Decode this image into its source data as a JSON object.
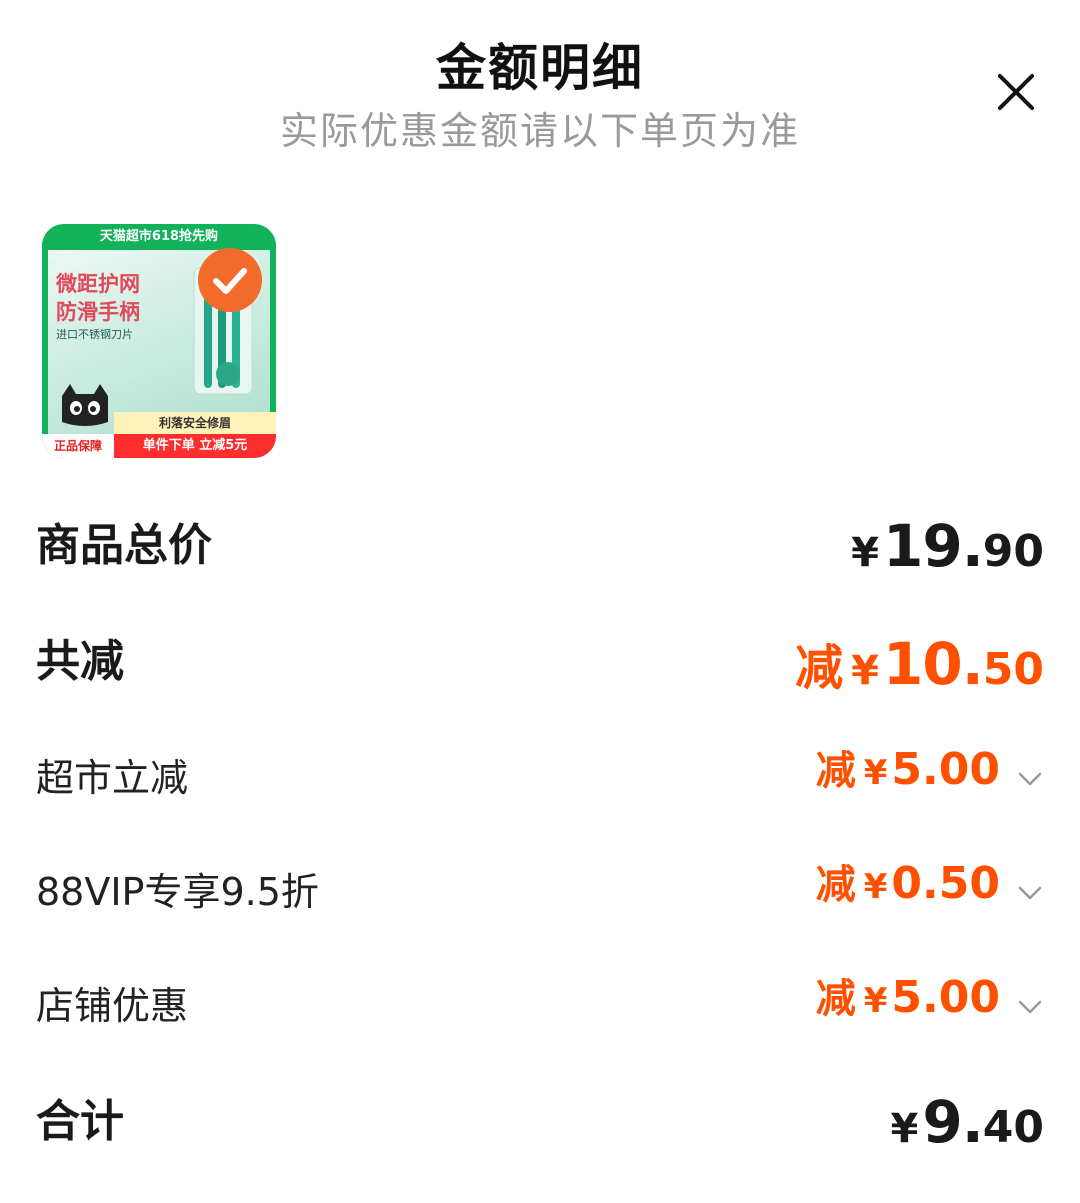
{
  "header": {
    "title": "金额明细",
    "subtitle": "实际优惠金额请以下单页为准",
    "close_label": "×"
  },
  "product": {
    "banner": "天猫超市618抢先购",
    "headline1": "微距护网",
    "headline2": "防滑手柄",
    "headline3": "进口不锈钢刀片",
    "bottom_strip": "利落安全修眉",
    "bottom_left": "正品保障",
    "bottom_right": "单件下单 立减5元",
    "selected": true
  },
  "rows": {
    "subtotal": {
      "label": "商品总价",
      "yen": "¥",
      "int": "19.",
      "dec": "90"
    },
    "total_discount": {
      "label": "共减",
      "prefix": "减",
      "yen": "¥",
      "int": "10.",
      "dec": "50"
    },
    "discounts": [
      {
        "label": "超市立减",
        "prefix": "减",
        "yen": "¥",
        "int": "5.",
        "dec": "00"
      },
      {
        "label": "88VIP专享9.5折",
        "prefix": "减",
        "yen": "¥",
        "int": "0.",
        "dec": "50"
      },
      {
        "label": "店铺优惠",
        "prefix": "减",
        "yen": "¥",
        "int": "5.",
        "dec": "00"
      }
    ],
    "total": {
      "label": "合计",
      "yen": "¥",
      "int": "9.",
      "dec": "40"
    }
  },
  "colors": {
    "accent_orange": "#ff5000",
    "subtitle_gray": "#9a9a9a",
    "text_dark": "#1a1a1a"
  },
  "icons": {
    "close": "close-icon",
    "chevron": "chevron-down-icon",
    "check": "check-icon"
  }
}
